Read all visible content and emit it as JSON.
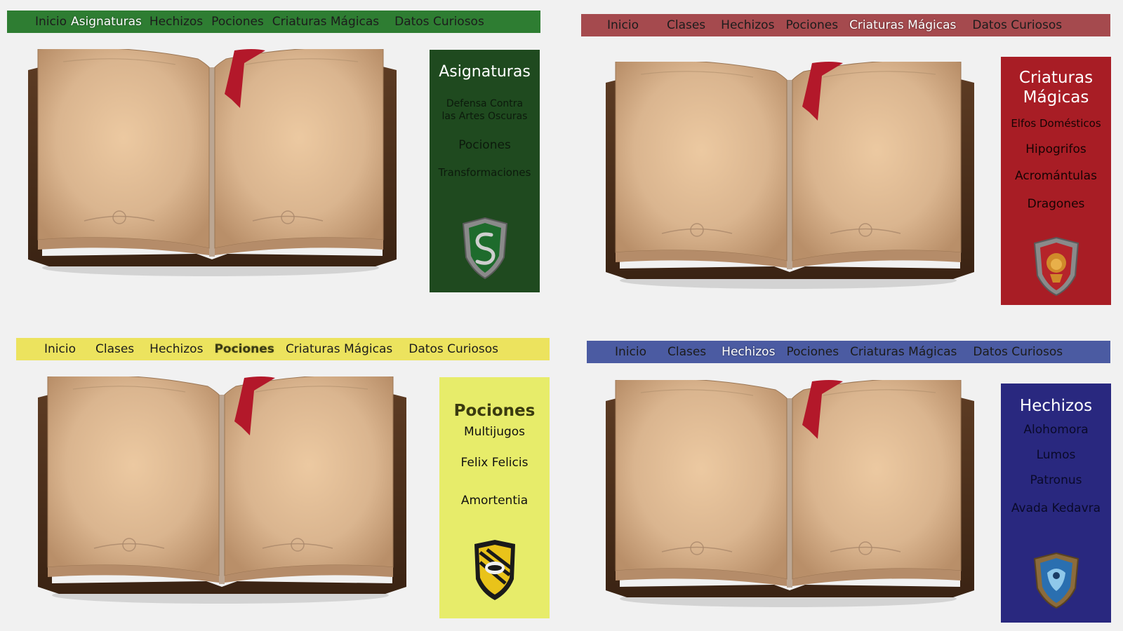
{
  "colors": {
    "green_nav": "#2e7d32",
    "green_panel": "#1f4a1f",
    "red_nav": "#a54a4e",
    "red_panel": "#a81d25",
    "yellow_nav": "#ece35e",
    "yellow_panel": "#e7ec6a",
    "blue_nav": "#4b5ba2",
    "blue_panel": "#29287f",
    "page_bg": "#f1f1f1",
    "bookmark": "#b3182a"
  },
  "slytherin": {
    "nav": [
      "Inicio",
      "Asignaturas",
      "Hechizos",
      "Pociones",
      "Criaturas Mágicas",
      "Datos Curiosos"
    ],
    "active_index": 1,
    "panel_title": "Asignaturas",
    "items": [
      "Defensa Contra las Artes Oscuras",
      "Pociones",
      "Transformaciones"
    ],
    "crest_icon": "slytherin-crest-icon"
  },
  "gryffindor": {
    "nav": [
      "Inicio",
      "Clases",
      "Hechizos",
      "Pociones",
      "Criaturas Mágicas",
      "Datos Curiosos"
    ],
    "active_index": 4,
    "panel_title": "Criaturas Mágicas",
    "items": [
      "Elfos Domésticos",
      "Hipogrifos",
      "Acromántulas",
      "Dragones"
    ],
    "crest_icon": "gryffindor-crest-icon"
  },
  "hufflepuff": {
    "nav": [
      "Inicio",
      "Clases",
      "Hechizos",
      "Pociones",
      "Criaturas Mágicas",
      "Datos Curiosos"
    ],
    "active_index": 3,
    "panel_title": "Pociones",
    "items": [
      "Multijugos",
      "Felix Felicis",
      "Amortentia"
    ],
    "crest_icon": "hufflepuff-crest-icon"
  },
  "ravenclaw": {
    "nav": [
      "Inicio",
      "Clases",
      "Hechizos",
      "Pociones",
      "Criaturas Mágicas",
      "Datos Curiosos"
    ],
    "active_index": 2,
    "panel_title": "Hechizos",
    "items": [
      "Alohomora",
      "Lumos",
      "Patronus",
      "Avada Kedavra"
    ],
    "crest_icon": "ravenclaw-crest-icon"
  }
}
